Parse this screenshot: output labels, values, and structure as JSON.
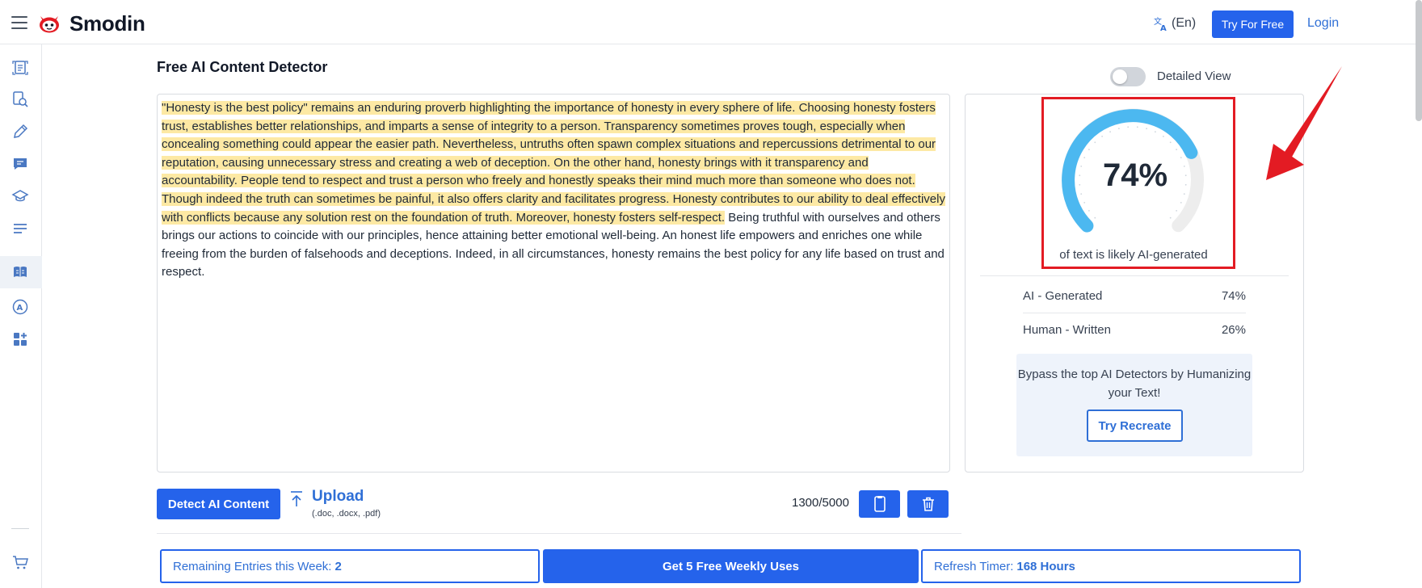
{
  "header": {
    "brand": "Smodin",
    "language": "(En)",
    "try_free": "Try For Free",
    "login": "Login"
  },
  "sidebar": {
    "items": [
      {
        "icon": "document-scan-icon"
      },
      {
        "icon": "search-document-icon"
      },
      {
        "icon": "pencil-icon"
      },
      {
        "icon": "chat-icon"
      },
      {
        "icon": "graduation-cap-icon"
      },
      {
        "icon": "text-lines-icon"
      },
      {
        "icon": "ai-detector-icon",
        "active": true
      },
      {
        "icon": "translate-circle-icon"
      },
      {
        "icon": "apps-icon"
      },
      {
        "icon": "cart-icon"
      }
    ]
  },
  "main": {
    "title": "Free AI Content Detector",
    "detailed_view_label": "Detailed View",
    "detailed_view_on": false,
    "text_highlighted": "\"Honesty is the best policy\" remains an enduring proverb highlighting the importance of honesty in every sphere of life. Choosing honesty fosters trust, establishes better relationships, and imparts a sense of integrity to a person. Transparency sometimes proves tough, especially when concealing something could appear the easier path. Nevertheless, untruths often spawn complex situations and repercussions detrimental to our reputation, causing unnecessary stress and creating a web of deception. On the other hand, honesty brings with it transparency and accountability. People tend to respect and trust a person who freely and honestly speaks their mind much more than someone who does not. Though indeed the truth can sometimes be painful, it also offers clarity and facilitates progress. Honesty contributes to our ability to deal effectively with conflicts because any solution rest on the foundation of truth. Moreover, honesty fosters self-respect.",
    "text_plain": " Being truthful with ourselves and others brings our actions to coincide with our principles, hence attaining better emotional well-being. An honest life empowers and enriches one while freeing from the burden of falsehoods and deceptions. Indeed, in all circumstances, honesty remains the best policy for any life based on trust and respect."
  },
  "results": {
    "gauge_value": "74%",
    "gauge_fraction": 0.74,
    "gauge_caption": "of text is likely AI-generated",
    "rows": [
      {
        "label": "AI - Generated",
        "value": "74%"
      },
      {
        "label": "Human - Written",
        "value": "26%"
      }
    ],
    "promo_text": "Bypass the top AI Detectors by Humanizing your Text!",
    "promo_button": "Try Recreate"
  },
  "toolbar": {
    "detect_button": "Detect AI Content",
    "upload_label": "Upload",
    "upload_formats": "(.doc, .docx, .pdf)",
    "char_count": "1300/5000"
  },
  "footer": {
    "remaining_label": "Remaining Entries this Week:",
    "remaining_value": "2",
    "cta": "Get 5 Free Weekly Uses",
    "timer_label": "Refresh Timer:",
    "timer_value": "168 Hours"
  },
  "colors": {
    "accent": "#2563eb",
    "highlight": "#fde9a4",
    "gauge_fill": "#4cb8f0",
    "gauge_track": "#ededed",
    "annotation_red": "#e31b23"
  }
}
